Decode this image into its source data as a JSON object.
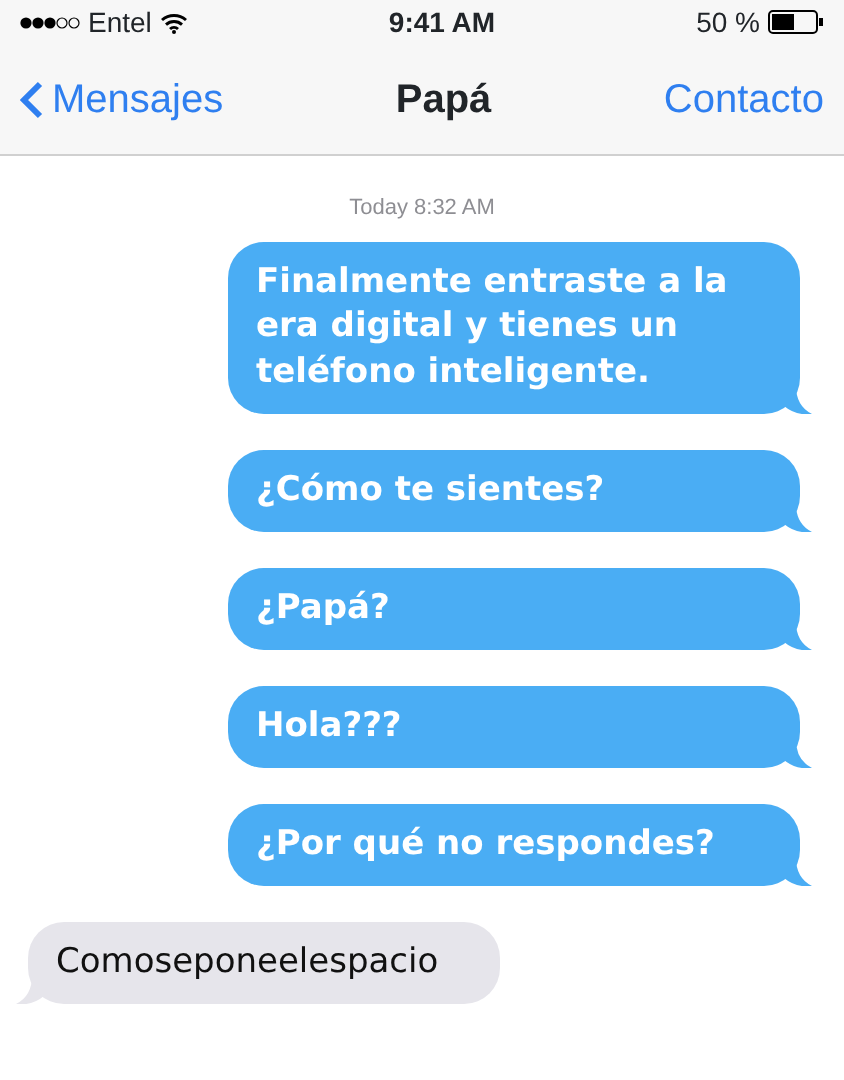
{
  "status_bar": {
    "carrier": "Entel",
    "time": "9:41 AM",
    "battery": "50 %"
  },
  "nav": {
    "back": "Mensajes",
    "title": "Papá",
    "action": "Contacto"
  },
  "timestamp": "Today 8:32 AM",
  "messages": [
    {
      "kind": "sent",
      "text": "Finalmente entraste a la era digital y tienes un teléfono inteligente."
    },
    {
      "kind": "sent",
      "text": "¿Cómo te sientes?"
    },
    {
      "kind": "sent",
      "text": "¿Papá?"
    },
    {
      "kind": "sent",
      "text": "Hola???"
    },
    {
      "kind": "sent",
      "text": "¿Por qué no respondes?"
    },
    {
      "kind": "received",
      "text": "Comoseponeelespacio"
    }
  ]
}
